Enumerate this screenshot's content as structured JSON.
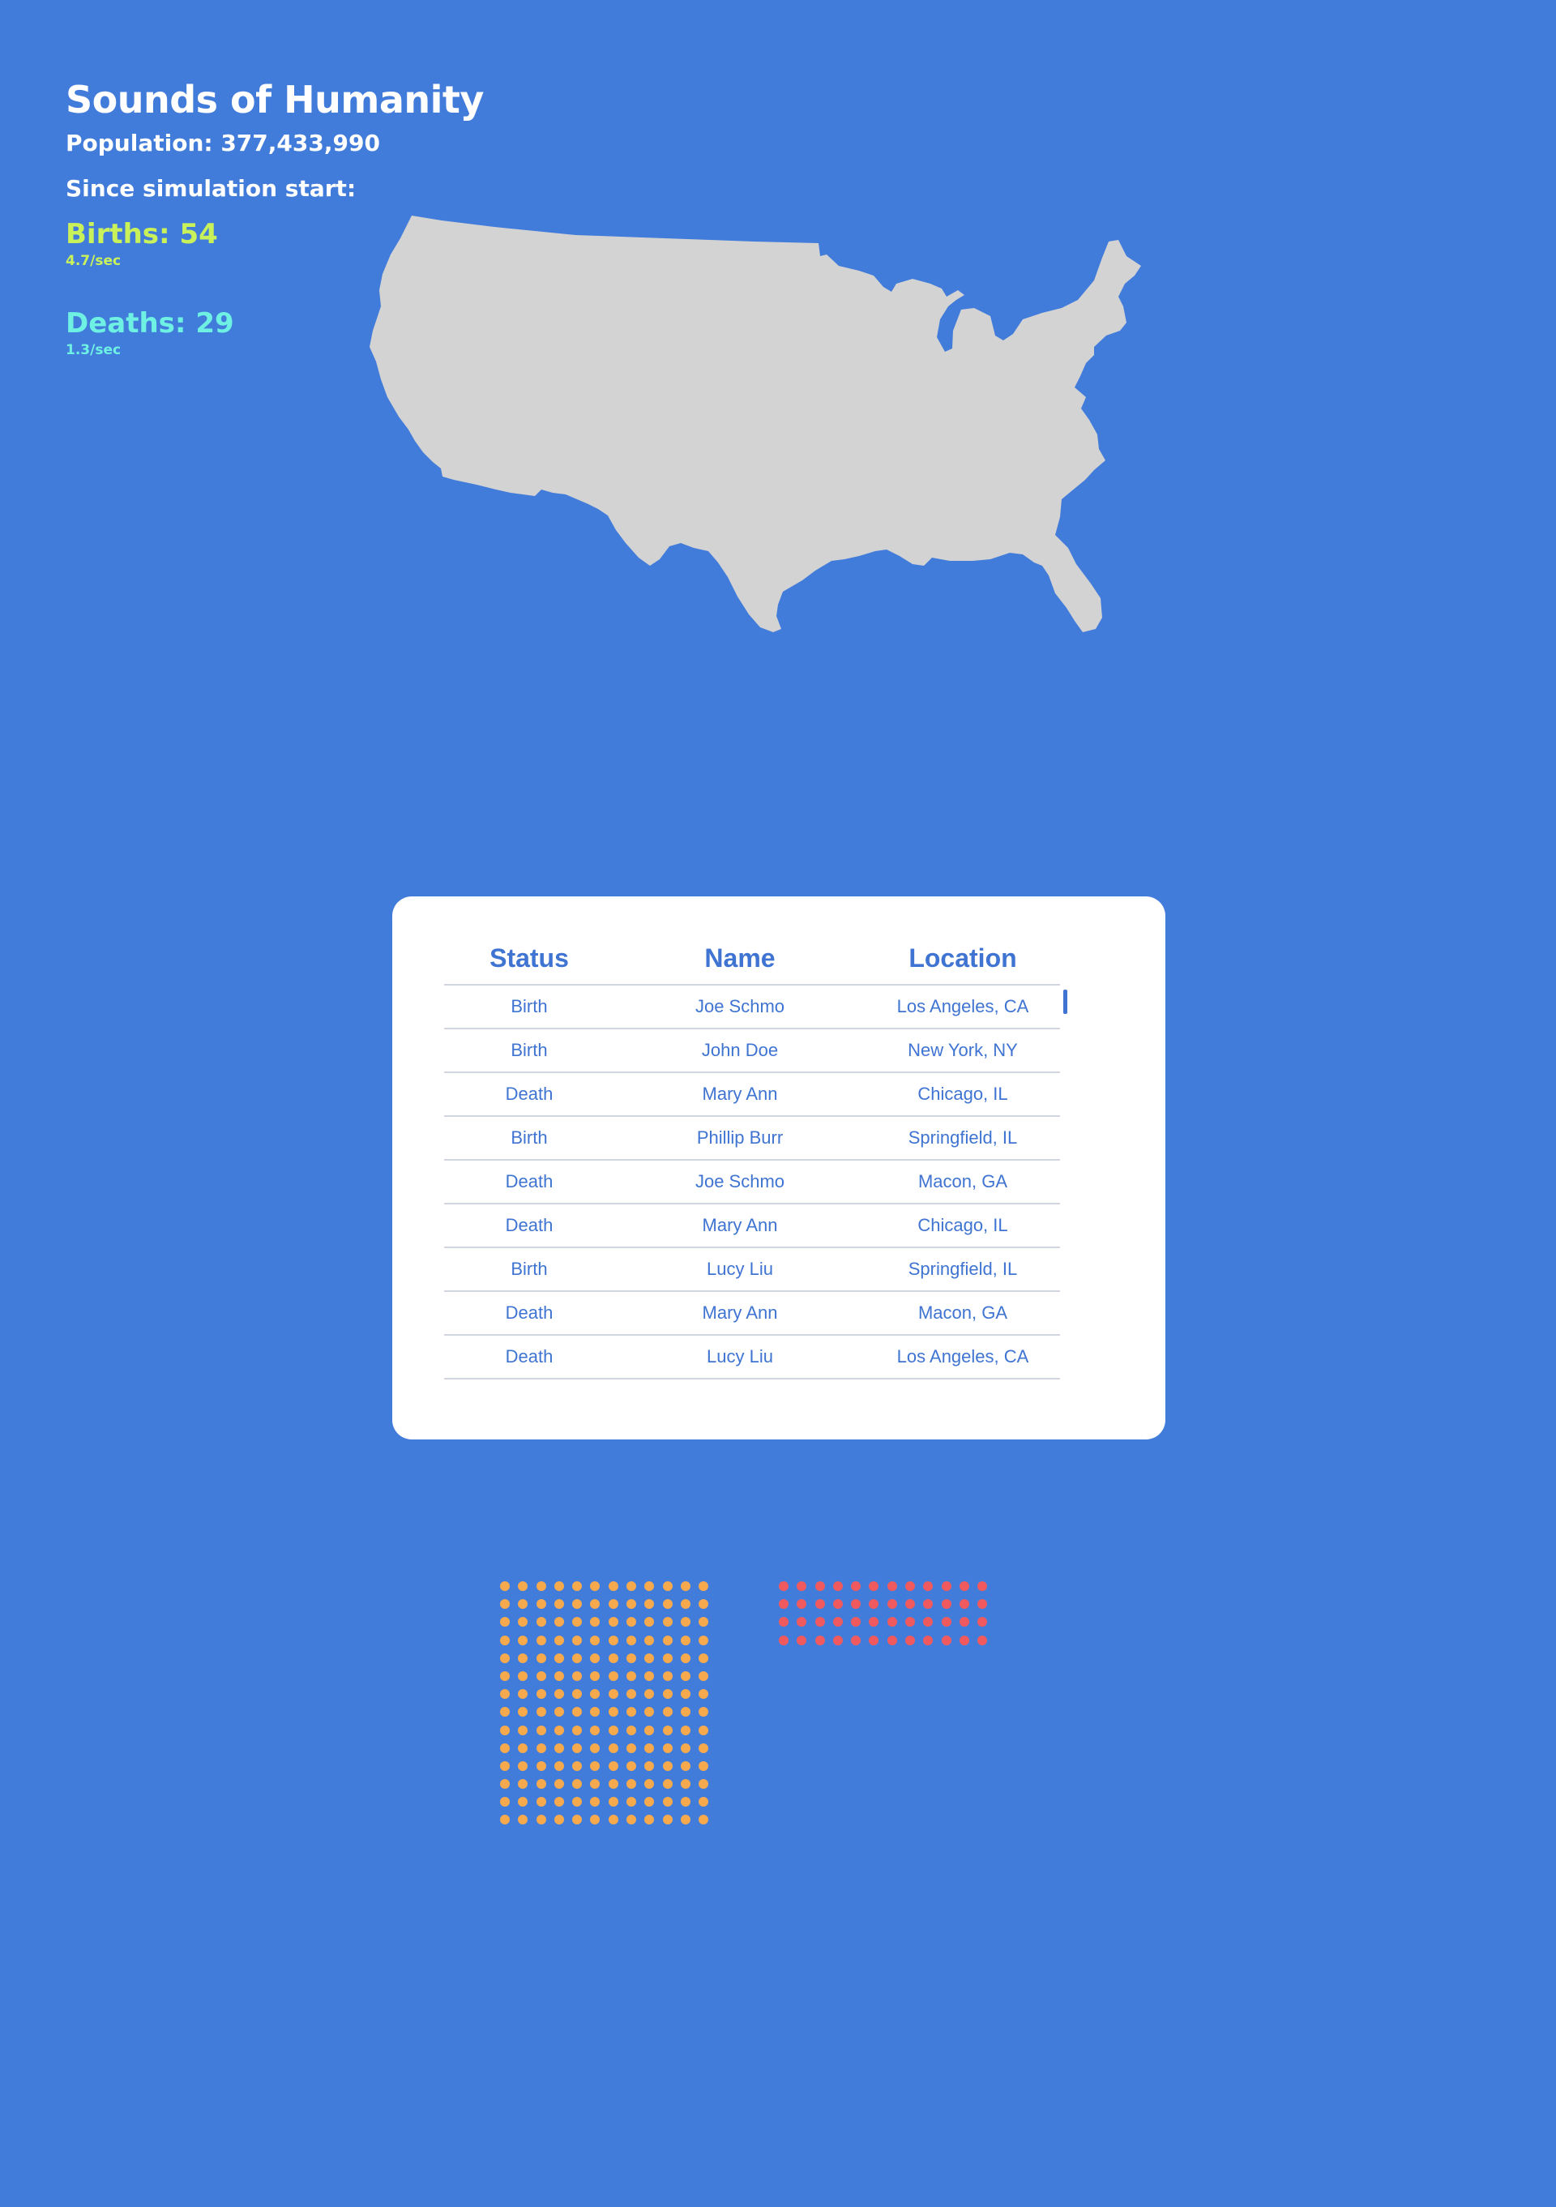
{
  "header": {
    "title": "Sounds of Humanity",
    "population_label": "Population: 377,433,990",
    "since_label": "Since simulation start:",
    "births_label": "Births: 54",
    "births_rate": "4.7/sec",
    "deaths_label": "Deaths: 29",
    "deaths_rate": "1.3/sec"
  },
  "colors": {
    "background": "#427cda",
    "births_accent": "#c9f25a",
    "deaths_accent": "#6ef0e3",
    "map_fill": "#d3d3d3",
    "birth_dot": "#f6aa4d",
    "death_dot": "#f05a5f",
    "table_text": "#3f74d2"
  },
  "map": {
    "icon": "usa-map"
  },
  "table": {
    "headers": [
      "Status",
      "Name",
      "Location"
    ],
    "rows": [
      [
        "Birth",
        "Joe Schmo",
        "Los Angeles, CA"
      ],
      [
        "Birth",
        "John Doe",
        "New York, NY"
      ],
      [
        "Death",
        "Mary Ann",
        "Chicago, IL"
      ],
      [
        "Birth",
        "Phillip Burr",
        "Springfield, IL"
      ],
      [
        "Death",
        "Joe Schmo",
        "Macon, GA"
      ],
      [
        "Death",
        "Mary Ann",
        "Chicago, IL"
      ],
      [
        "Birth",
        "Lucy Liu",
        "Springfield, IL"
      ],
      [
        "Death",
        "Mary Ann",
        "Macon, GA"
      ],
      [
        "Death",
        "Lucy Liu",
        "Los Angeles, CA"
      ]
    ]
  },
  "dot_grids": {
    "births": {
      "count": 168
    },
    "deaths": {
      "count": 48
    }
  }
}
